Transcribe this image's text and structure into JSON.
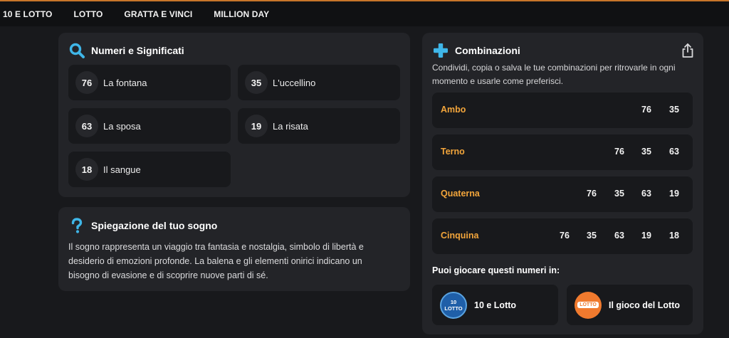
{
  "nav": {
    "items": [
      "10 E LOTTO",
      "LOTTO",
      "GRATTA E VINCI",
      "MILLION DAY"
    ]
  },
  "numeri": {
    "title": "Numeri e Significati",
    "items": [
      {
        "number": "76",
        "meaning": "La fontana"
      },
      {
        "number": "35",
        "meaning": "L'uccellino"
      },
      {
        "number": "63",
        "meaning": "La sposa"
      },
      {
        "number": "19",
        "meaning": "La risata"
      },
      {
        "number": "18",
        "meaning": "Il sangue"
      }
    ]
  },
  "spiegazione": {
    "title": "Spiegazione del tuo sogno",
    "text": "Il sogno rappresenta un viaggio tra fantasia e nostalgia, simbolo di libertà e desiderio di emozioni profonde. La balena e gli elementi onirici indicano un bisogno di evasione e di scoprire nuove parti di sé."
  },
  "combinazioni": {
    "title": "Combinazioni",
    "description": "Condividi, copia o salva le tue combinazioni per ritrovarle in ogni momento e usarle come preferisci.",
    "rows": [
      {
        "label": "Ambo",
        "numbers": [
          "76",
          "35"
        ]
      },
      {
        "label": "Terno",
        "numbers": [
          "76",
          "35",
          "63"
        ]
      },
      {
        "label": "Quaterna",
        "numbers": [
          "76",
          "35",
          "63",
          "19"
        ]
      },
      {
        "label": "Cinquina",
        "numbers": [
          "76",
          "35",
          "63",
          "19",
          "18"
        ]
      }
    ],
    "play_label": "Puoi giocare questi numeri in:",
    "games": [
      {
        "name": "10 e Lotto",
        "logo_text": "10 LOTTO"
      },
      {
        "name": "Il gioco del Lotto",
        "logo_text": "LOTTO"
      }
    ]
  },
  "colors": {
    "accent": "#f2a53b",
    "background": "#18191c",
    "card": "#232428",
    "icon_blue": "#3fb6e8"
  },
  "icons": {
    "numeri": "search-icon",
    "spiegazione": "question-icon",
    "combinazioni": "plus-icon",
    "share": "share-icon"
  }
}
